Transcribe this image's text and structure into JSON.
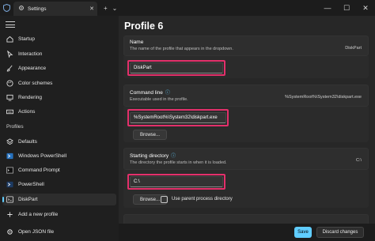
{
  "window": {
    "tab_title": "Settings",
    "tab_close": "✕",
    "new_tab": "+",
    "tab_dropdown": "⌄",
    "minimize": "—",
    "maximize": "☐",
    "close": "✕"
  },
  "sidebar": {
    "items": [
      {
        "label": "Startup",
        "icon": "home-icon"
      },
      {
        "label": "Interaction",
        "icon": "cursor-icon"
      },
      {
        "label": "Appearance",
        "icon": "brush-icon"
      },
      {
        "label": "Color schemes",
        "icon": "palette-icon"
      },
      {
        "label": "Rendering",
        "icon": "monitor-icon"
      },
      {
        "label": "Actions",
        "icon": "keyboard-icon"
      }
    ],
    "profiles_heading": "Profiles",
    "profiles": [
      {
        "label": "Defaults",
        "icon": "layers-icon"
      },
      {
        "label": "Windows PowerShell",
        "icon": "powershell-icon"
      },
      {
        "label": "Command Prompt",
        "icon": "cmd-icon"
      },
      {
        "label": "PowerShell",
        "icon": "powershell-icon"
      },
      {
        "label": "DiskPart",
        "icon": "terminal-icon",
        "active": true
      }
    ],
    "add_profile": "Add a new profile",
    "open_json": "Open JSON file"
  },
  "main": {
    "title": "Profile 6",
    "name_section": {
      "title": "Name",
      "description": "The name of the profile that appears in the dropdown.",
      "value_preview": "DiskPart",
      "input_value": "DiskPart"
    },
    "command_section": {
      "title": "Command line",
      "description": "Executable used in the profile.",
      "value_preview": "%SystemRoot%\\System32\\diskpart.exe",
      "input_value": "%SystemRoot%\\System32\\diskpart.exe",
      "browse_label": "Browse..."
    },
    "directory_section": {
      "title": "Starting directory",
      "description": "The directory the profile starts in when it is loaded.",
      "value_preview": "C:\\",
      "input_value": "C:\\",
      "browse_label": "Browse...",
      "checkbox_label": "Use parent process directory",
      "checkbox_checked": false
    }
  },
  "footer": {
    "save_label": "Save",
    "discard_label": "Discard changes"
  },
  "colors": {
    "accent": "#60cdff",
    "highlight": "#e3306b"
  }
}
